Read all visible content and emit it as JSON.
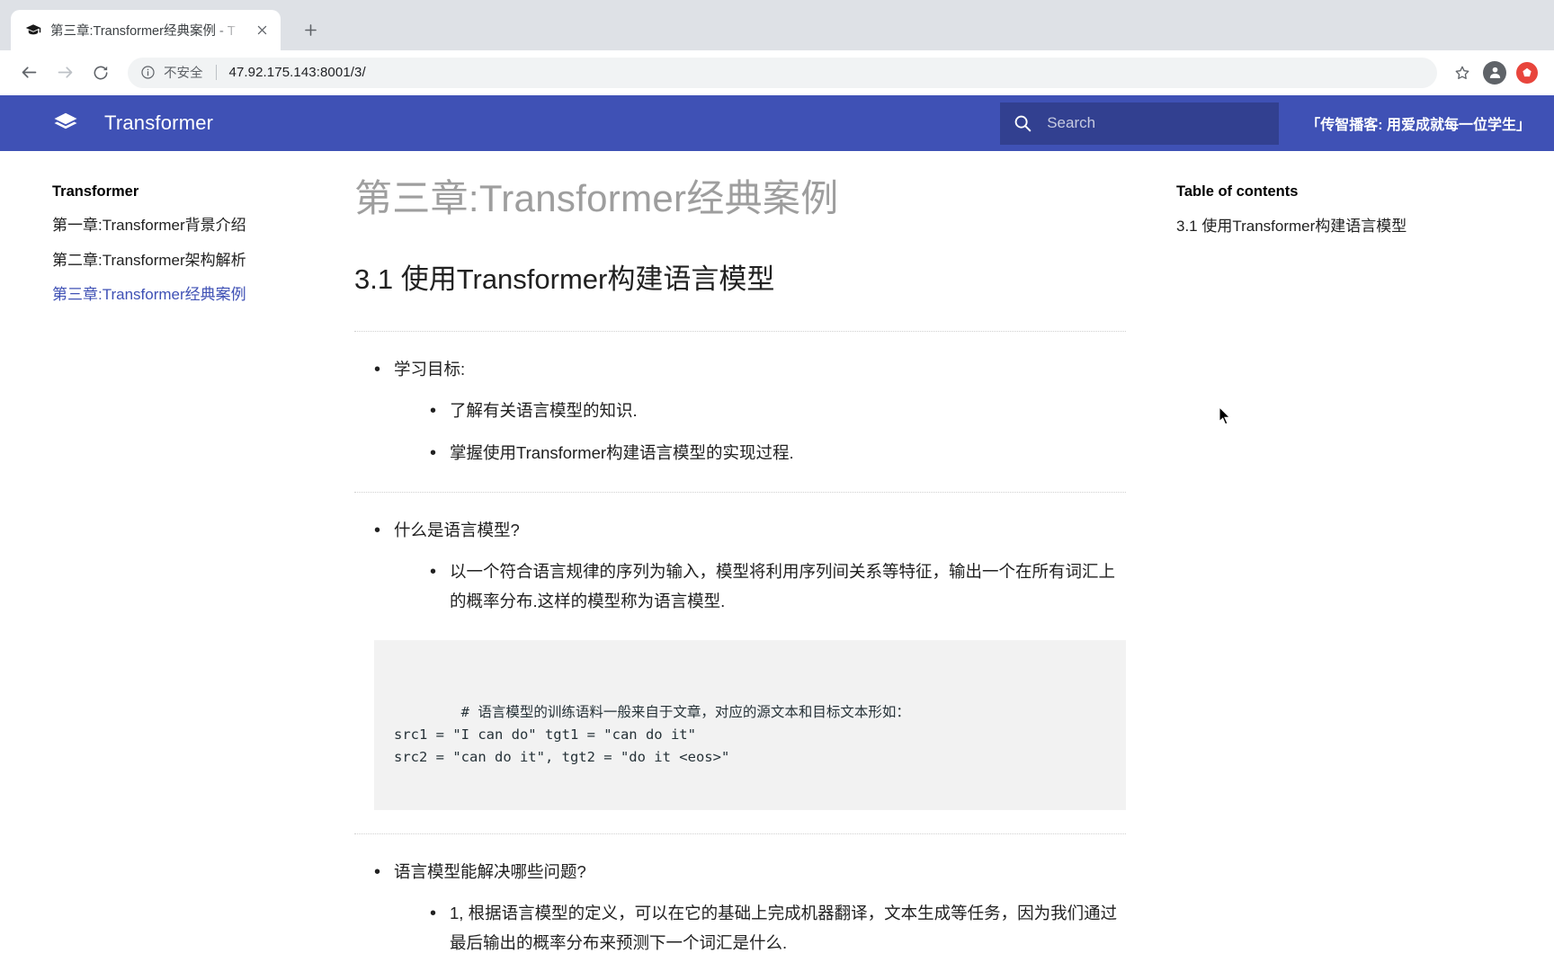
{
  "browser": {
    "tab": {
      "title": "第三章:Transformer经典案例 - T",
      "favicon_icon": "graduation-cap-icon",
      "close_icon": "close-icon"
    },
    "new_tab_label": "+",
    "nav": {
      "back_icon": "arrow-back-icon",
      "forward_icon": "arrow-forward-icon",
      "reload_icon": "reload-icon"
    },
    "omnibox": {
      "info_icon": "info-circle-icon",
      "security_label": "不安全",
      "url": "47.92.175.143:8001/3/",
      "url_host": "47.92.175.143",
      "url_rest": ":8001/3/"
    },
    "toolbar_icons": {
      "bookmark": "star-icon",
      "profile": "account-avatar-icon",
      "extension": "extension-red-icon"
    }
  },
  "site_header": {
    "logo_icon": "mkdocs-material-logo-icon",
    "title": "Transformer",
    "search": {
      "icon": "search-icon",
      "placeholder": "Search",
      "value": ""
    },
    "slogan": "「传智播客: 用爱成就每一位学生」",
    "background_color": "#3f51b5"
  },
  "sidebar": {
    "heading": "Transformer",
    "items": [
      {
        "label": "第一章:Transformer背景介绍",
        "active": false
      },
      {
        "label": "第二章:Transformer架构解析",
        "active": false
      },
      {
        "label": "第三章:Transformer经典案例",
        "active": true
      }
    ],
    "active_color": "#3f51b5"
  },
  "main": {
    "title": "第三章:Transformer经典案例",
    "section_heading": "3.1 使用Transformer构建语言模型",
    "blocks": [
      {
        "bullet": "学习目标:",
        "children": [
          "了解有关语言模型的知识.",
          "掌握使用Transformer构建语言模型的实现过程."
        ]
      },
      {
        "bullet": "什么是语言模型?",
        "children": [
          "以一个符合语言规律的序列为输入，模型将利用序列间关系等特征，输出一个在所有词汇上的概率分布.这样的模型称为语言模型."
        ]
      },
      {
        "bullet": "语言模型能解决哪些问题?",
        "children": [
          "1, 根据语言模型的定义，可以在它的基础上完成机器翻译，文本生成等任务，因为我们通过最后输出的概率分布来预测下一个词汇是什么."
        ]
      }
    ],
    "code_block": {
      "copy_icon": "copy-icon",
      "text": "# 语言模型的训练语料一般来自于文章，对应的源文本和目标文本形如：\nsrc1 = \"I can do\" tgt1 = \"can do it\"\nsrc2 = \"can do it\", tgt2 = \"do it <eos>\""
    }
  },
  "toc": {
    "heading": "Table of contents",
    "items": [
      {
        "label": "3.1 使用Transformer构建语言模型"
      }
    ]
  },
  "cursor": {
    "icon": "mouse-pointer-icon"
  }
}
